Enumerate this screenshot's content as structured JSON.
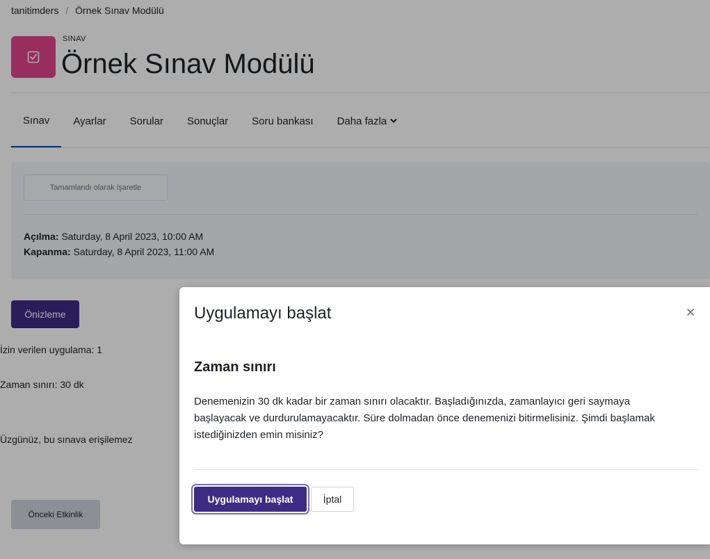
{
  "breadcrumb": {
    "course": "tanitimders",
    "separator": "/",
    "current": "Örnek Sınav Modülü"
  },
  "module": {
    "kind": "SINAV",
    "title": "Örnek Sınav Modülü",
    "icon": "checkbox-icon",
    "icon_color": "#e0448b"
  },
  "tabs": [
    {
      "label": "Sınav"
    },
    {
      "label": "Ayarlar"
    },
    {
      "label": "Sorular"
    },
    {
      "label": "Sonuçlar"
    },
    {
      "label": "Soru bankası"
    },
    {
      "label": "Daha fazla"
    }
  ],
  "activity": {
    "mark_done_label": "Tamamlandı olarak işaretle",
    "open_label": "Açılma:",
    "open_value": "Saturday, 8 April 2023, 10:00 AM",
    "close_label": "Kapanma:",
    "close_value": "Saturday, 8 April 2023, 11:00 AM"
  },
  "main": {
    "preview_label": "Önizleme",
    "attempts_allowed": "İzin verilen uygulama: 1",
    "time_limit": "Zaman sınırı: 30 dk",
    "no_access": "Üzgünüz, bu sınava erişilemez",
    "prev_activity_label": "Önceki Etkinlik"
  },
  "modal": {
    "title": "Uygulamayı başlat",
    "close_icon": "close-icon",
    "heading": "Zaman sınırı",
    "body": "Denemenizin 30 dk kadar bir zaman sınırı olacaktır. Başladığınızda, zamanlayıcı geri saymaya başlayacak ve durdurulamayacaktır. Süre dolmadan önce denemenizi bitirmelisiniz. Şimdi başlamak istediğinizden emin misiniz?",
    "start_label": "Uygulamayı başlat",
    "cancel_label": "İptal"
  },
  "colors": {
    "primary": "#3e2c84",
    "tab_active_border": "#0f47ad"
  }
}
